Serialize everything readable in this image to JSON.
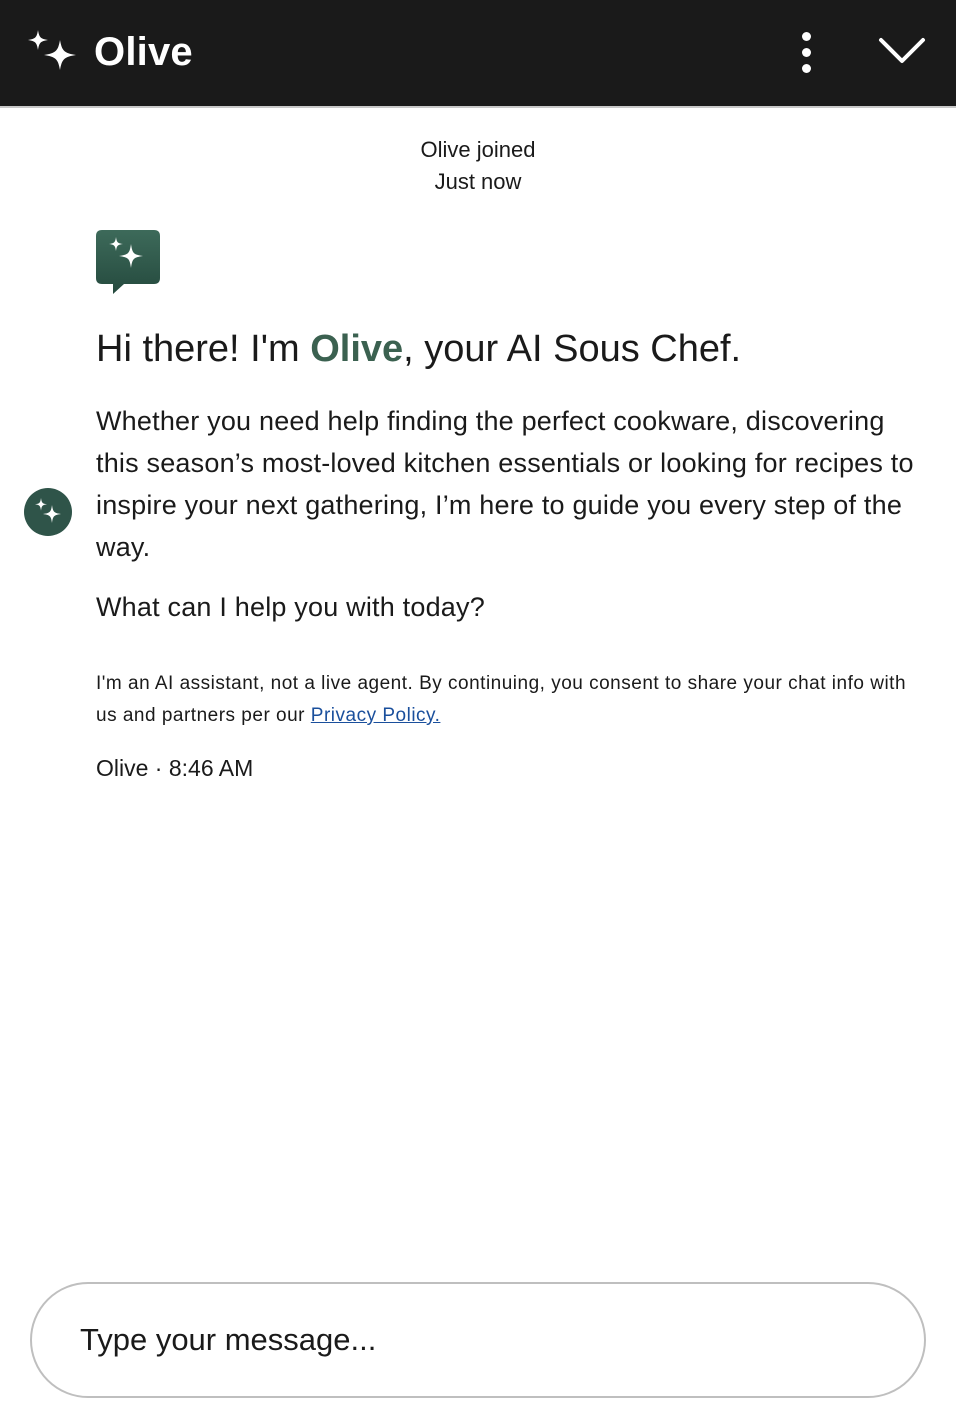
{
  "header": {
    "title": "Olive",
    "background": "#1a1a1a",
    "icons": {
      "brand": "sparkles-icon",
      "menu": "more-vertical-icon",
      "collapse": "chevron-down-icon"
    }
  },
  "join_notice": {
    "line1": "Olive joined",
    "line2": "Just now"
  },
  "message": {
    "greeting_prefix": "Hi there! I'm ",
    "greeting_name": "Olive",
    "greeting_suffix": ", your AI Sous Chef.",
    "intro": "Whether you need help finding the perfect cookware, discovering this season’s most-loved kitchen essentials or looking for recipes to inspire your next gathering, I’m here to guide you every step of the way.",
    "question": "What can I help you with today?",
    "disclaimer_text": "I'm an AI assistant, not a live agent. By continuing, you consent to share your chat info with us and partners per our ",
    "privacy_link": "Privacy Policy.",
    "sender": "Olive",
    "separator": "·",
    "time": "8:46 AM"
  },
  "composer": {
    "placeholder": "Type your message..."
  },
  "colors": {
    "brand_green": "#3b6150",
    "badge_green": "#2f5449",
    "link": "#1a4f9c"
  }
}
